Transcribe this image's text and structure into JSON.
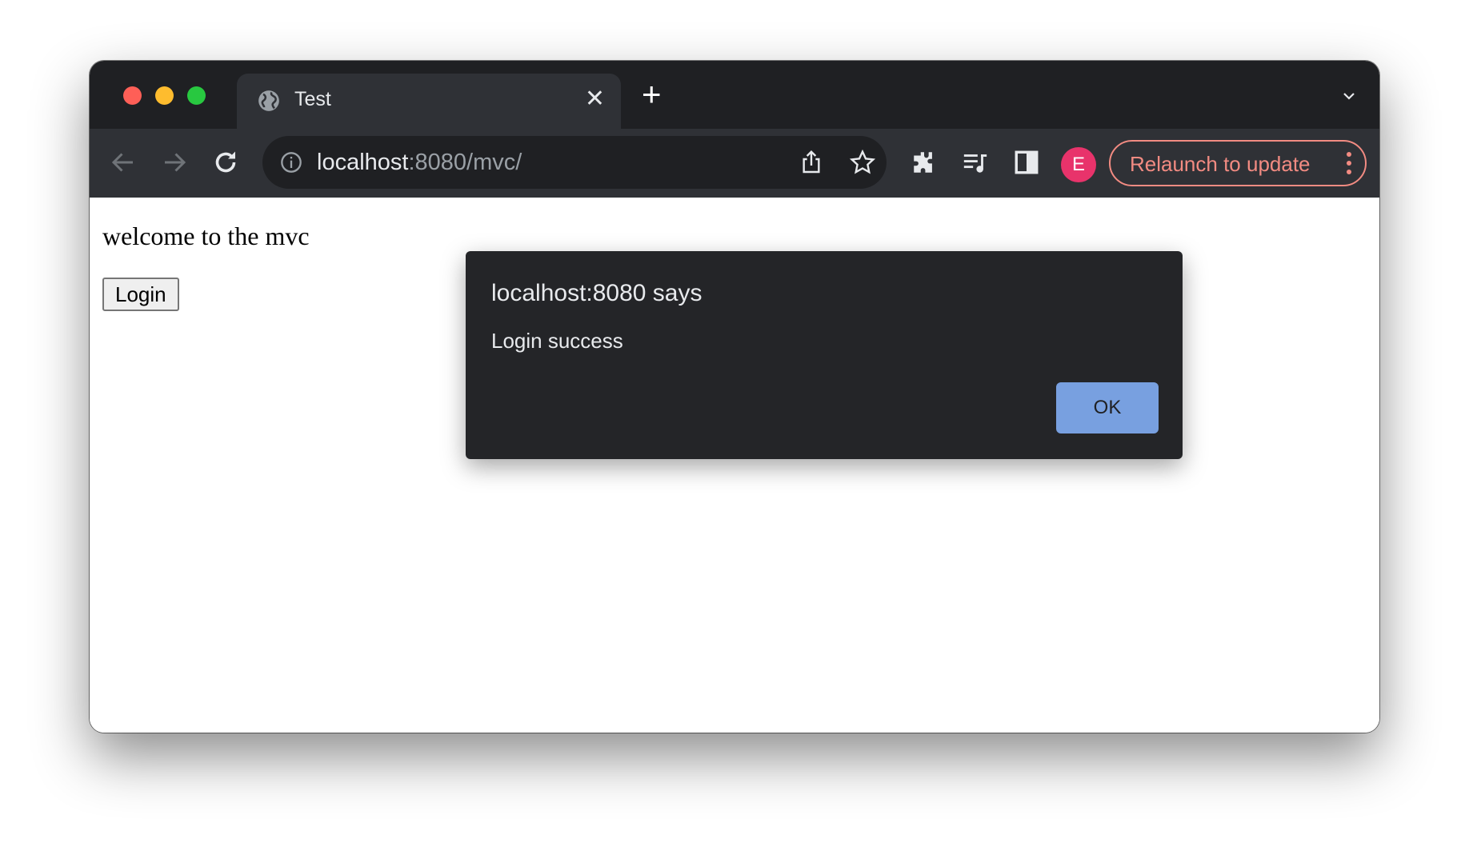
{
  "browser": {
    "tab": {
      "title": "Test",
      "close_label": "✕"
    },
    "new_tab_label": "+",
    "address_bar": {
      "host": "localhost",
      "rest": ":8080/mvc/"
    },
    "profile_initial": "E",
    "relaunch_label": "Relaunch to update"
  },
  "page": {
    "welcome_text": "welcome to the mvc",
    "login_button": "Login"
  },
  "dialog": {
    "title": "localhost:8080 says",
    "message": "Login success",
    "ok_label": "OK",
    "accent_color": "#78a0e0"
  }
}
